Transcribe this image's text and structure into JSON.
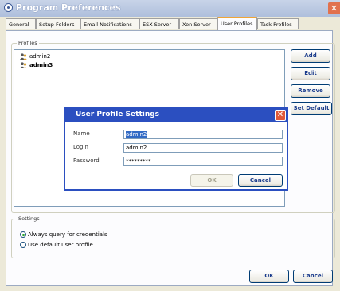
{
  "window": {
    "title": "Program Preferences",
    "close_glyph": "✕"
  },
  "tabs": [
    {
      "label": "General"
    },
    {
      "label": "Setup Folders"
    },
    {
      "label": "Email Notifications"
    },
    {
      "label": "ESX Server"
    },
    {
      "label": "Xen Server"
    },
    {
      "label": "User Profiles"
    },
    {
      "label": "Task Profiles"
    }
  ],
  "active_tab": "User Profiles",
  "profiles": {
    "legend": "Profiles",
    "items": [
      {
        "label": "admin2",
        "bold": false
      },
      {
        "label": "admin3",
        "bold": true
      }
    ],
    "buttons": {
      "add": "Add",
      "edit": "Edit",
      "remove": "Remove",
      "set_default": "Set Default"
    }
  },
  "settings": {
    "legend": "Settings",
    "options": [
      {
        "label": "Always query for credentials",
        "selected": true
      },
      {
        "label": "Use default user profile",
        "selected": false
      }
    ]
  },
  "footer": {
    "ok": "OK",
    "cancel": "Cancel"
  },
  "dialog": {
    "title": "User Profile Settings",
    "close_glyph": "✕",
    "fields": {
      "name": {
        "label": "Name",
        "value": "admin2"
      },
      "login": {
        "label": "Login",
        "value": "admin2"
      },
      "password": {
        "label": "Password",
        "value": "*********"
      }
    },
    "ok": "OK",
    "cancel": "Cancel"
  },
  "colors": {
    "dialog_accent": "#2b4fc0",
    "close_button": "#e0593a",
    "tab_highlight": "#f0a536"
  }
}
